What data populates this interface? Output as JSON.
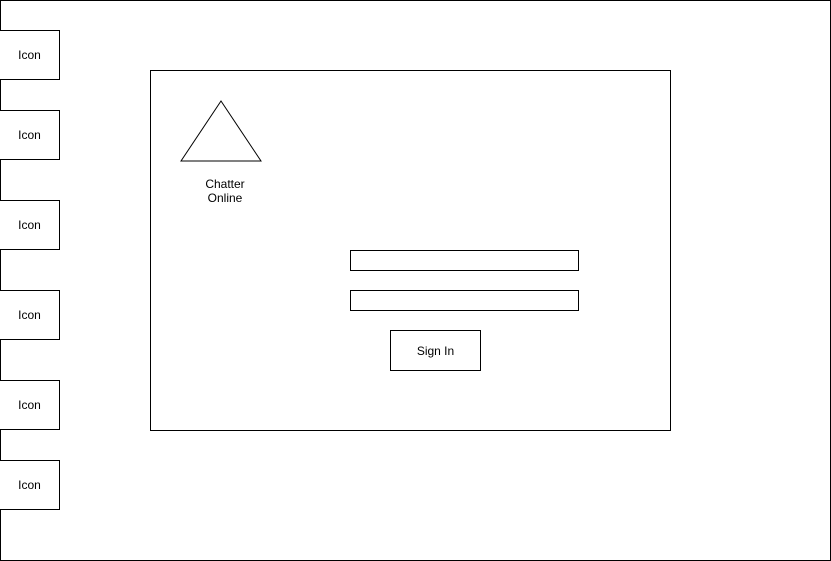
{
  "sidebar": {
    "items": [
      {
        "label": "Icon"
      },
      {
        "label": "Icon"
      },
      {
        "label": "Icon"
      },
      {
        "label": "Icon"
      },
      {
        "label": "Icon"
      },
      {
        "label": "Icon"
      }
    ]
  },
  "login": {
    "logo_icon": "triangle-logo-icon",
    "logo_text": "Chatter\nOnline",
    "username": {
      "value": "",
      "placeholder": ""
    },
    "password": {
      "value": "",
      "placeholder": ""
    },
    "signin_label": "Sign In"
  }
}
